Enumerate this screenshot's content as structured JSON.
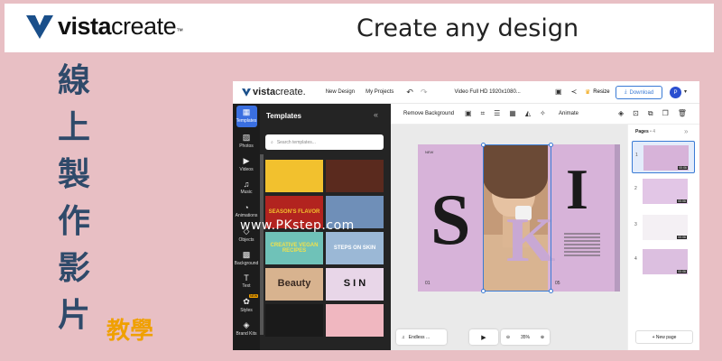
{
  "banner": {
    "logo_bold": "vista",
    "logo_light": "create",
    "logo_tm": "™",
    "title": "Create any design"
  },
  "side_title": {
    "chars": [
      "線",
      "上",
      "製",
      "作",
      "影",
      "片"
    ],
    "tag": "教學"
  },
  "watermark": "www.PKstep.com",
  "editor": {
    "topbar": {
      "logo_bold": "vista",
      "logo_light": "create.",
      "new_design": "New Design",
      "my_projects": "My Projects",
      "file_name": "Video Full HD 1920x1080...",
      "resize": "Resize",
      "download": "Download",
      "avatar_initial": "P"
    },
    "rail": [
      {
        "label": "Templates",
        "icon": "templates-icon"
      },
      {
        "label": "Photos",
        "icon": "photos-icon"
      },
      {
        "label": "Videos",
        "icon": "videos-icon"
      },
      {
        "label": "Music",
        "icon": "music-icon"
      },
      {
        "label": "Animations",
        "icon": "animations-icon"
      },
      {
        "label": "Objects",
        "icon": "objects-icon"
      },
      {
        "label": "Background",
        "icon": "background-icon"
      },
      {
        "label": "Text",
        "icon": "text-icon"
      },
      {
        "label": "Styles",
        "icon": "styles-icon",
        "badge": "NEW"
      },
      {
        "label": "Brand Kits",
        "icon": "brand-kits-icon"
      }
    ],
    "templates_panel": {
      "title": "Templates",
      "search_placeholder": "Search templates...",
      "thumbs": [
        {
          "text": "",
          "color": "#f2c12e"
        },
        {
          "text": "",
          "color": "#5a2a1e"
        },
        {
          "text": "SEASON'S FLAVOR",
          "color": "#b2231f"
        },
        {
          "text": "",
          "color": "#6f8fb8"
        },
        {
          "text": "CREATIVE VEGAN RECIPES",
          "color": "#6fc2b8"
        },
        {
          "text": "STEPS ON SKIN",
          "color": "#9bb8d6"
        },
        {
          "text": "Beauty",
          "color": "#d8b38f"
        },
        {
          "text": "S I N",
          "color": "#e8d6e8"
        },
        {
          "text": "",
          "color": "#1a1a1a"
        },
        {
          "text": "",
          "color": "#f0b7c0"
        }
      ]
    },
    "context_toolbar": {
      "remove_bg": "Remove Background",
      "animate": "Animate"
    },
    "canvas": {
      "new_label": "NEW",
      "left_num": "01",
      "right_num": "05",
      "letter_s": "S",
      "letter_k": "K",
      "letter_i": "I"
    },
    "bottom": {
      "music": "Endless ...",
      "zoom": "35%"
    },
    "pages_panel": {
      "title": "Pages",
      "count": "• 4",
      "pages": [
        {
          "num": "1",
          "dur": "00:06"
        },
        {
          "num": "2",
          "dur": "00:06"
        },
        {
          "num": "3",
          "dur": "00:06"
        },
        {
          "num": "4",
          "dur": "00:06"
        }
      ],
      "new_page": "+ New page"
    }
  },
  "colors": {
    "background": "#e8bfc4",
    "title_blue": "#2f4a6a",
    "tag_orange": "#f0a000",
    "accent_blue": "#3a7bd5",
    "canvas_purple": "#d7b3d9"
  }
}
